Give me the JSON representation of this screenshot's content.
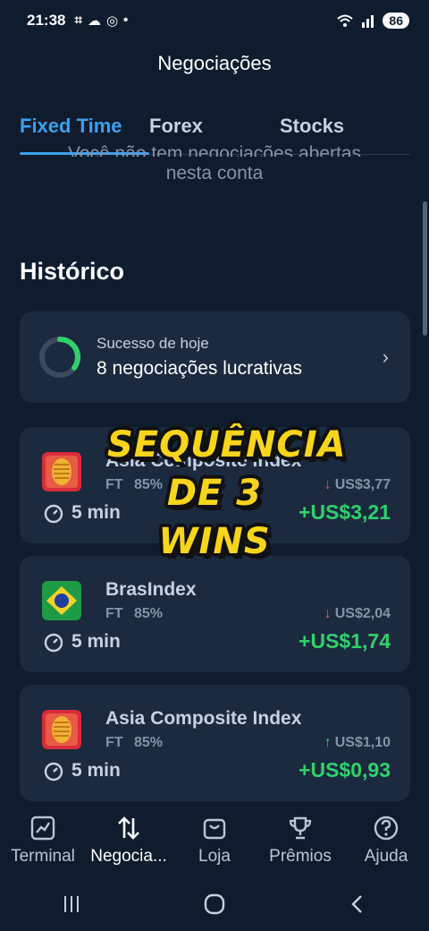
{
  "status": {
    "time": "21:38",
    "battery": "86"
  },
  "header": {
    "title": "Negociações"
  },
  "tabs": [
    {
      "label": "Fixed Time"
    },
    {
      "label": "Forex"
    },
    {
      "label": "Stocks"
    }
  ],
  "empty": {
    "line1": "Você não tem negociações abertas",
    "line2": "nesta conta"
  },
  "history": {
    "title": "Histórico",
    "success_label": "Sucesso de hoje",
    "success_value": "8 negociações lucrativas",
    "success_progress": 0.35
  },
  "trades": [
    {
      "asset": "Asia Composite Index",
      "type": "FT",
      "pct": "85%",
      "direction": "down",
      "invest": "US$3,77",
      "duration": "5 min",
      "profit": "+US$3,21",
      "flag": "asean"
    },
    {
      "asset": "BrasIndex",
      "type": "FT",
      "pct": "85%",
      "direction": "down",
      "invest": "US$2,04",
      "duration": "5 min",
      "profit": "+US$1,74",
      "flag": "brazil"
    },
    {
      "asset": "Asia Composite Index",
      "type": "FT",
      "pct": "85%",
      "direction": "up",
      "invest": "US$1,10",
      "duration": "5 min",
      "profit": "+US$0,93",
      "flag": "asean"
    }
  ],
  "overlay": {
    "line1": "SEQUÊNCIA",
    "line2": "DE 3 WINS"
  },
  "nav": [
    {
      "label": "Terminal",
      "icon": "chart-icon"
    },
    {
      "label": "Negocia...",
      "icon": "swap-arrows-icon"
    },
    {
      "label": "Loja",
      "icon": "shopping-bag-icon"
    },
    {
      "label": "Prêmios",
      "icon": "trophy-icon"
    },
    {
      "label": "Ajuda",
      "icon": "help-icon"
    }
  ],
  "colors": {
    "background": "#0f1c2e",
    "card": "#1b2a3f",
    "accent": "#3aa0ee",
    "profit": "#2fd26a",
    "loss": "#e85757",
    "sticker": "#f8d51a"
  }
}
